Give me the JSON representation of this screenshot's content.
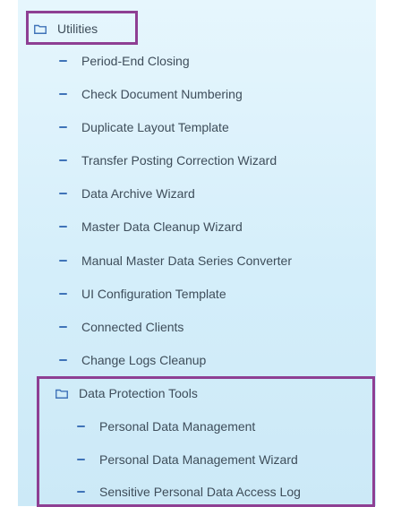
{
  "tree": {
    "utilities": {
      "label": "Utilities",
      "icon": "folder-icon",
      "children": [
        "Period-End Closing",
        "Check Document Numbering",
        "Duplicate Layout Template",
        "Transfer Posting Correction Wizard",
        "Data Archive Wizard",
        "Master Data Cleanup Wizard",
        "Manual Master Data Series Converter",
        "UI Configuration Template",
        "Connected Clients",
        "Change Logs Cleanup"
      ]
    },
    "data_protection": {
      "label": "Data Protection Tools",
      "icon": "folder-icon",
      "children": [
        "Personal Data Management",
        "Personal Data Management Wizard",
        "Sensitive Personal Data Access Log"
      ]
    }
  },
  "colors": {
    "highlight": "#8e3f93",
    "bullet": "#3f73b8",
    "folder": "#3f73b8",
    "text": "#3e4d5a"
  }
}
